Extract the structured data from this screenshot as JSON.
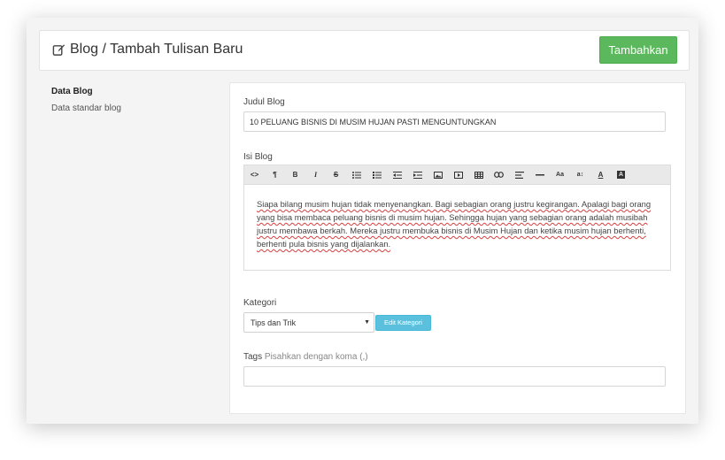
{
  "header": {
    "title": "Blog / Tambah Tulisan Baru",
    "add_button": "Tambahkan"
  },
  "sidebar": {
    "section_title": "Data Blog",
    "section_desc": "Data standar blog"
  },
  "form": {
    "title_label": "Judul Blog",
    "title_value": "10 PELUANG BISNIS DI MUSIM HUJAN PASTI MENGUNTUNGKAN",
    "content_label": "Isi Blog",
    "content_text": "Siapa bilang musim hujan tidak menyenangkan. Bagi sebagian orang justru kegirangan. Apalagi bagi orang yang bisa membaca peluang bisnis di musim hujan. Sehingga hujan yang sebagian orang adalah musibah justru membawa berkah. Mereka justru membuka bisnis di Musim Hujan dan ketika musim hujan berhenti, berhenti pula bisnis yang dijalankan.",
    "category_label": "Kategori",
    "category_selected": "Tips dan Trik",
    "edit_category_button": "Edit Kategori",
    "tags_label": "Tags",
    "tags_hint": "Pisahkan dengan koma (,)",
    "tags_value": ""
  },
  "toolbar": {
    "buttons": [
      "code-view",
      "paragraph",
      "bold",
      "italic",
      "strikethrough",
      "unordered-list",
      "ordered-list",
      "outdent",
      "indent",
      "image",
      "video",
      "table",
      "link",
      "alignment",
      "horizontal-rule",
      "font-size",
      "line-height",
      "text-color",
      "background-color"
    ]
  },
  "colors": {
    "primary_button": "#5cb85c",
    "info_button": "#5bc0de"
  }
}
